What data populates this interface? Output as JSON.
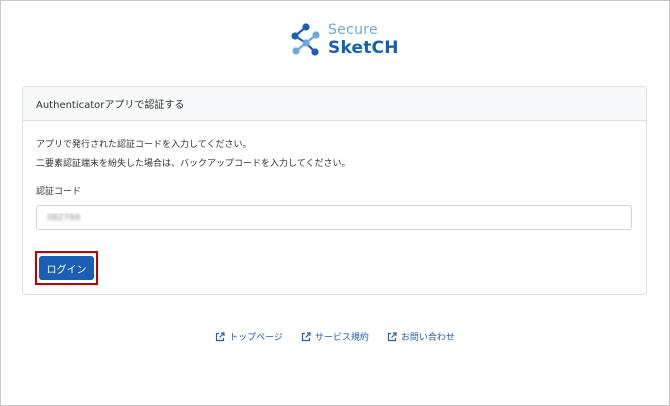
{
  "logo": {
    "line1": "Secure",
    "line2": "SketCH",
    "icon": "network-nodes-icon"
  },
  "card": {
    "header_title": "Authenticatorアプリで認証する",
    "description_line1": "アプリで発行された認証コードを入力してください。",
    "description_line2": "二要素認証端末を紛失した場合は、バックアップコードを入力してください。",
    "code_label": "認証コード",
    "code_value": "382794",
    "login_label": "ログイン"
  },
  "footer": {
    "links": [
      {
        "label": "トップページ",
        "icon": "external-link-icon"
      },
      {
        "label": "サービス規約",
        "icon": "external-link-icon"
      },
      {
        "label": "お問い合わせ",
        "icon": "external-link-icon"
      }
    ]
  },
  "colors": {
    "brand_primary": "#1a5fb4",
    "brand_light": "#6da8e0",
    "highlight_border": "#c00000"
  }
}
